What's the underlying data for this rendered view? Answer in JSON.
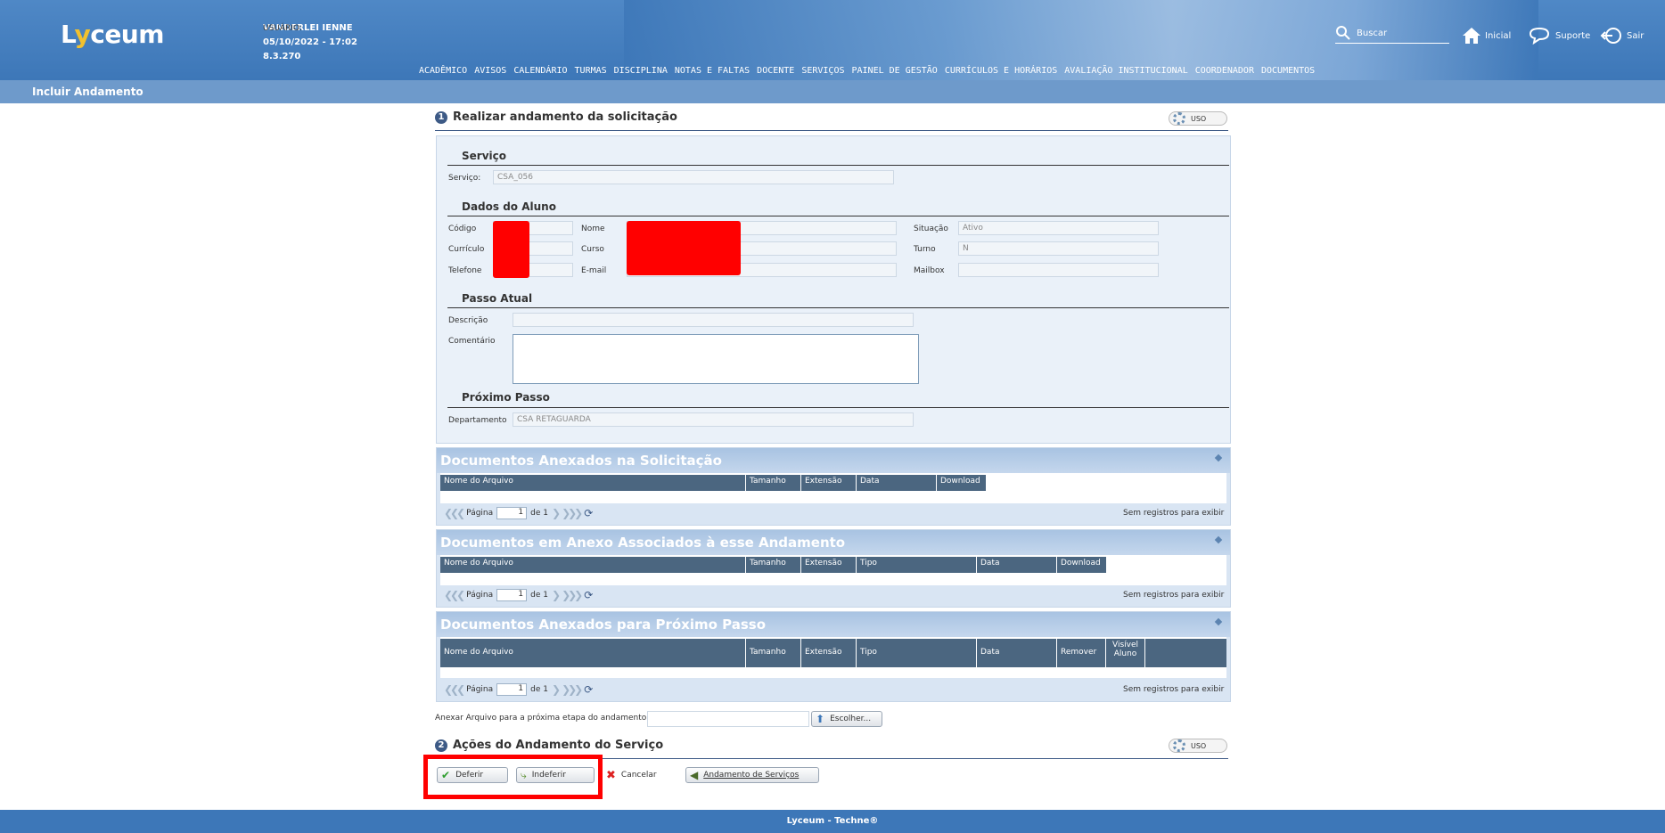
{
  "header": {
    "logo": {
      "l": "L",
      "y": "y",
      "rest": "ceum"
    },
    "user_label": "USUÁRIO:",
    "user_name": "VANDERLEI IENNE",
    "datetime": "05/10/2022 - 17:02",
    "version": "8.3.270",
    "search_placeholder": "Buscar",
    "nav_home": "Inicial",
    "nav_support": "Suporte",
    "nav_exit": "Sair",
    "menu": [
      "ACADÊMICO",
      "AVISOS",
      "CALENDÁRIO",
      "TURMAS",
      "DISCIPLINA",
      "NOTAS E FALTAS",
      "DOCENTE",
      "SERVIÇOS",
      "PAINEL DE GESTÃO",
      "CURRÍCULOS E HORÁRIOS",
      "AVALIAÇÃO INSTITUCIONAL",
      "COORDENADOR",
      "DOCUMENTOS"
    ]
  },
  "page_title": "Incluir Andamento",
  "section1": {
    "number": "1",
    "title": "Realizar andamento da solicitação",
    "uso": "USO",
    "servico": {
      "heading": "Serviço",
      "label": "Serviço:",
      "value": "CSA_056"
    },
    "aluno": {
      "heading": "Dados do Aluno",
      "codigo": "Código",
      "nome": "Nome",
      "situacao": "Situação",
      "situacao_value": "Ativo",
      "curriculo": "Currículo",
      "curso": "Curso",
      "turno": "Turno",
      "turno_value": "N",
      "telefone": "Telefone",
      "email": "E-mail",
      "mailbox": "Mailbox"
    },
    "passo": {
      "heading": "Passo Atual",
      "descricao": "Descrição",
      "comentario": "Comentário"
    },
    "proximo": {
      "heading": "Próximo Passo",
      "departamento": "Departamento",
      "departamento_value": "CSA RETAGUARDA"
    }
  },
  "grids": [
    {
      "title": "Documentos Anexados na Solicitação",
      "columns": [
        "Nome do Arquivo",
        "Tamanho",
        "Extensão",
        "Data",
        "Download"
      ]
    },
    {
      "title": "Documentos em Anexo Associados à esse Andamento",
      "columns": [
        "Nome do Arquivo",
        "Tamanho",
        "Extensão",
        "Tipo",
        "Data",
        "Download"
      ]
    },
    {
      "title": "Documentos Anexados para Próximo Passo",
      "columns": [
        "Nome do Arquivo",
        "Tamanho",
        "Extensão",
        "Tipo",
        "Data",
        "Remover",
        "Visível Aluno"
      ]
    }
  ],
  "pager": {
    "label": "Página",
    "page": "1",
    "of": "de 1",
    "no_records": "Sem registros para exibir"
  },
  "attach": {
    "label": "Anexar Arquivo para a próxima etapa do andamento",
    "button": "Escolher..."
  },
  "section2": {
    "number": "2",
    "title": "Ações do Andamento do Serviço",
    "uso": "USO"
  },
  "actions": {
    "deferir": "Deferir",
    "indeferir": "Indeferir",
    "cancelar": "Cancelar",
    "andamento": "Andamento de Serviços"
  },
  "footer": "Lyceum - Techne®"
}
